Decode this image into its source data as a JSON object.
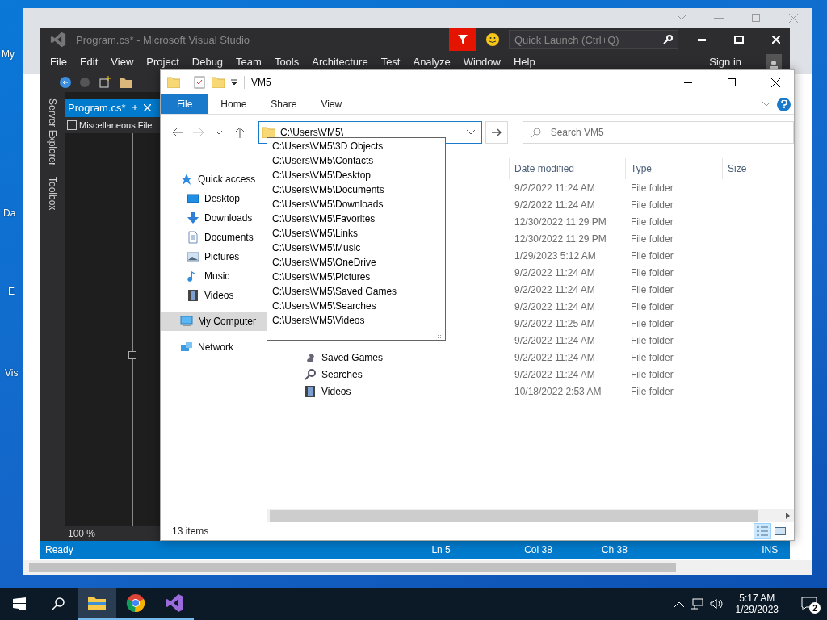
{
  "desktop": {
    "icons": [
      "My",
      "Da",
      "E",
      "Vis"
    ]
  },
  "visual_studio": {
    "title": "Program.cs* - Microsoft Visual Studio",
    "quick_launch": {
      "placeholder": "Quick Launch (Ctrl+Q)"
    },
    "menu": [
      "File",
      "Edit",
      "View",
      "Project",
      "Debug",
      "Team",
      "Tools",
      "Architecture",
      "Test",
      "Analyze",
      "Window",
      "Help"
    ],
    "sign_in": "Sign in",
    "side_tabs": [
      "Server Explorer",
      "Toolbox"
    ],
    "document_tab": {
      "label": "Program.cs*",
      "selected": true
    },
    "navigation_bar": "Miscellaneous File",
    "zoom": "100 %",
    "status_bar": [
      "Ready",
      "Ln 5",
      "Col 38",
      "Ch 38",
      "INS"
    ]
  },
  "explorer": {
    "title": "VM5",
    "ribbon_tabs": [
      {
        "label": "File",
        "selected": true
      },
      {
        "label": "Home",
        "selected": false
      },
      {
        "label": "Share",
        "selected": false
      },
      {
        "label": "View",
        "selected": false
      }
    ],
    "address": "C:\\Users\\VM5\\",
    "suggestions": [
      "C:\\Users\\VM5\\3D Objects",
      "C:\\Users\\VM5\\Contacts",
      "C:\\Users\\VM5\\Desktop",
      "C:\\Users\\VM5\\Documents",
      "C:\\Users\\VM5\\Downloads",
      "C:\\Users\\VM5\\Favorites",
      "C:\\Users\\VM5\\Links",
      "C:\\Users\\VM5\\Music",
      "C:\\Users\\VM5\\OneDrive",
      "C:\\Users\\VM5\\Pictures",
      "C:\\Users\\VM5\\Saved Games",
      "C:\\Users\\VM5\\Searches",
      "C:\\Users\\VM5\\Videos"
    ],
    "search": {
      "placeholder": "Search VM5"
    },
    "nav_pane": [
      {
        "label": "Quick access",
        "kind": "star",
        "selected": false,
        "children": [
          {
            "label": "Desktop",
            "kind": "desktop",
            "selected": false
          },
          {
            "label": "Downloads",
            "kind": "downloads",
            "selected": false
          },
          {
            "label": "Documents",
            "kind": "documents",
            "selected": false
          },
          {
            "label": "Pictures",
            "kind": "pictures",
            "selected": false
          },
          {
            "label": "Music",
            "kind": "music",
            "selected": false
          },
          {
            "label": "Videos",
            "kind": "videos",
            "selected": false
          }
        ]
      },
      {
        "label": "My Computer",
        "kind": "computer",
        "selected": true
      },
      {
        "label": "Network",
        "kind": "network",
        "selected": false
      }
    ],
    "columns": [
      "Date modified",
      "Type",
      "Size"
    ],
    "rows": [
      {
        "date": "9/2/2022 11:24 AM",
        "type": "File folder"
      },
      {
        "date": "9/2/2022 11:24 AM",
        "type": "File folder"
      },
      {
        "date": "12/30/2022 11:29 PM",
        "type": "File folder"
      },
      {
        "date": "12/30/2022 11:29 PM",
        "type": "File folder"
      },
      {
        "date": "1/29/2023 5:12 AM",
        "type": "File folder"
      },
      {
        "date": "9/2/2022 11:24 AM",
        "type": "File folder"
      },
      {
        "date": "9/2/2022 11:24 AM",
        "type": "File folder"
      },
      {
        "date": "9/2/2022 11:24 AM",
        "type": "File folder"
      },
      {
        "date": "9/2/2022 11:25 AM",
        "type": "File folder"
      },
      {
        "date": "9/2/2022 11:24 AM",
        "type": "File folder"
      },
      {
        "name": "Saved Games",
        "kind": "saved-games",
        "date": "9/2/2022 11:24 AM",
        "type": "File folder"
      },
      {
        "name": "Searches",
        "kind": "searches",
        "date": "9/2/2022 11:24 AM",
        "type": "File folder"
      },
      {
        "name": "Videos",
        "kind": "videos",
        "date": "10/18/2022 2:53 AM",
        "type": "File folder"
      }
    ],
    "status": "13 items"
  },
  "taskbar": {
    "apps": [
      {
        "kind": "explorer",
        "selected": true
      },
      {
        "kind": "chrome",
        "selected": false
      },
      {
        "kind": "visual-studio",
        "selected": false
      }
    ],
    "time": "5:17 AM",
    "date": "1/29/2023",
    "notifications": "2"
  }
}
